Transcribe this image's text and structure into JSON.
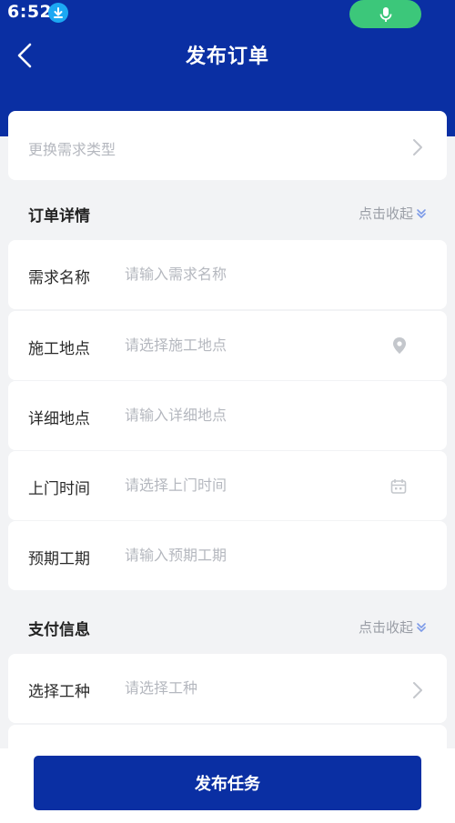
{
  "status_bar": {
    "time": "6:52"
  },
  "header": {
    "title": "发布订单"
  },
  "demand_type": {
    "placeholder": "更换需求类型"
  },
  "order_section": {
    "title": "订单详情",
    "collapse_label": "点击收起",
    "fields": [
      {
        "label": "需求名称",
        "placeholder": "请输入需求名称"
      },
      {
        "label": "施工地点",
        "placeholder": "请选择施工地点",
        "icon": "location-pin-icon"
      },
      {
        "label": "详细地点",
        "placeholder": "请输入详细地点"
      },
      {
        "label": "上门时间",
        "placeholder": "请选择上门时间",
        "icon": "calendar-icon"
      },
      {
        "label": "预期工期",
        "placeholder": "请输入预期工期"
      }
    ]
  },
  "payment_section": {
    "title": "支付信息",
    "collapse_label": "点击收起",
    "fields": [
      {
        "label": "选择工种",
        "placeholder": "请选择工种",
        "icon": "chevron-right-icon"
      }
    ]
  },
  "footer": {
    "publish_label": "发布任务"
  },
  "colors": {
    "brand": "#0a2fa3",
    "background": "#f2f3f5",
    "placeholder": "#b5b8bf",
    "mic_green": "#3cc77a",
    "download_blue": "#1ca8f3"
  }
}
